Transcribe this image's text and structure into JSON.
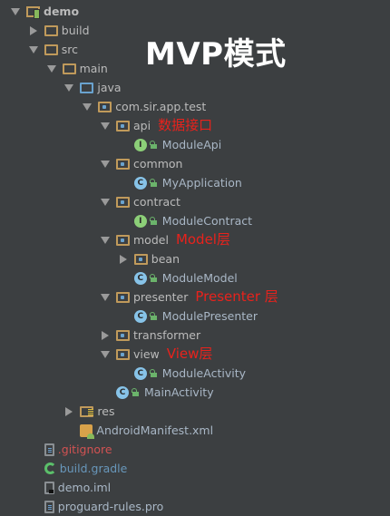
{
  "overlay_title": "MVP模式",
  "tree": [
    {
      "label": "demo",
      "depth": 0,
      "arrow": "down",
      "icon": "module-icon",
      "style": "bold"
    },
    {
      "label": "build",
      "depth": 1,
      "arrow": "right",
      "icon": "folder-icon"
    },
    {
      "label": "src",
      "depth": 1,
      "arrow": "down",
      "icon": "folder-icon"
    },
    {
      "label": "main",
      "depth": 2,
      "arrow": "down",
      "icon": "folder-icon"
    },
    {
      "label": "java",
      "depth": 3,
      "arrow": "down",
      "icon": "source-folder-icon"
    },
    {
      "label": "com.sir.app.test",
      "depth": 4,
      "arrow": "down",
      "icon": "package-icon"
    },
    {
      "label": "api",
      "depth": 5,
      "arrow": "down",
      "icon": "package-icon",
      "note": "数据接口"
    },
    {
      "label": "ModuleApi",
      "depth": 6,
      "icon": "interface-icon",
      "style": "src"
    },
    {
      "label": "common",
      "depth": 5,
      "arrow": "down",
      "icon": "package-icon"
    },
    {
      "label": "MyApplication",
      "depth": 6,
      "icon": "class-icon",
      "style": "src"
    },
    {
      "label": "contract",
      "depth": 5,
      "arrow": "down",
      "icon": "package-icon"
    },
    {
      "label": "ModuleContract",
      "depth": 6,
      "icon": "interface-icon",
      "style": "src"
    },
    {
      "label": "model",
      "depth": 5,
      "arrow": "down",
      "icon": "package-icon",
      "note": "Model层"
    },
    {
      "label": "bean",
      "depth": 6,
      "arrow": "right",
      "icon": "package-icon"
    },
    {
      "label": "ModuleModel",
      "depth": 6,
      "icon": "class-icon",
      "style": "src"
    },
    {
      "label": "presenter",
      "depth": 5,
      "arrow": "down",
      "icon": "package-icon",
      "note": "Presenter 层"
    },
    {
      "label": "ModulePresenter",
      "depth": 6,
      "icon": "class-icon",
      "style": "src"
    },
    {
      "label": "transformer",
      "depth": 5,
      "arrow": "right",
      "icon": "package-icon"
    },
    {
      "label": "view",
      "depth": 5,
      "arrow": "down",
      "icon": "package-icon",
      "note": "View层"
    },
    {
      "label": "ModuleActivity",
      "depth": 6,
      "icon": "class-icon",
      "style": "src"
    },
    {
      "label": "MainActivity",
      "depth": 5,
      "icon": "class-icon",
      "style": "src"
    },
    {
      "label": "res",
      "depth": 3,
      "arrow": "right",
      "icon": "resource-folder-icon"
    },
    {
      "label": "AndroidManifest.xml",
      "depth": 3,
      "icon": "manifest-icon",
      "style": "src"
    },
    {
      "label": ".gitignore",
      "depth": 1,
      "icon": "text-file-icon",
      "style": "ignored"
    },
    {
      "label": "build.gradle",
      "depth": 1,
      "icon": "gradle-icon",
      "style": "gradle-c"
    },
    {
      "label": "demo.iml",
      "depth": 1,
      "icon": "iml-file-icon",
      "style": "src"
    },
    {
      "label": "proguard-rules.pro",
      "depth": 1,
      "icon": "text-file-icon",
      "style": "src"
    }
  ],
  "colors": {
    "background": "#3c3f41",
    "annotation": "#e8221c",
    "ignored": "#d25252",
    "gradle": "#6897bb"
  }
}
